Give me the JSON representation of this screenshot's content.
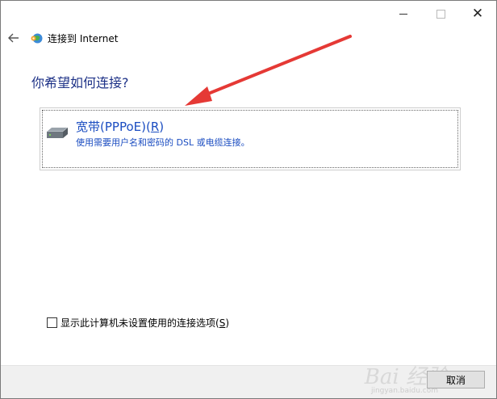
{
  "window": {
    "title": "连接到 Internet",
    "controls": {
      "minimize": "minimize",
      "maximize": "maximize",
      "close": "✕"
    }
  },
  "header": {
    "back_icon": "arrow-left-icon",
    "app_icon": "network-globe-icon"
  },
  "main": {
    "question": "你希望如何连接?",
    "options": [
      {
        "title_text": "宽带(PPPoE)(",
        "title_accel": "R",
        "title_close": ")",
        "description": "使用需要用户名和密码的 DSL 或电缆连接。",
        "icon": "modem-icon"
      }
    ]
  },
  "footer_options": {
    "checkbox_label": "显示此计算机未设置使用的连接选项(",
    "checkbox_accel": "S",
    "checkbox_close": ")",
    "checked": false
  },
  "buttons": {
    "cancel": "取消"
  },
  "watermark": {
    "text": "Bai 经验",
    "sub": "jingyan.baidu.com"
  },
  "colors": {
    "heading": "#1e3287",
    "link": "#1b4dc1",
    "annotation": "#e53935"
  }
}
